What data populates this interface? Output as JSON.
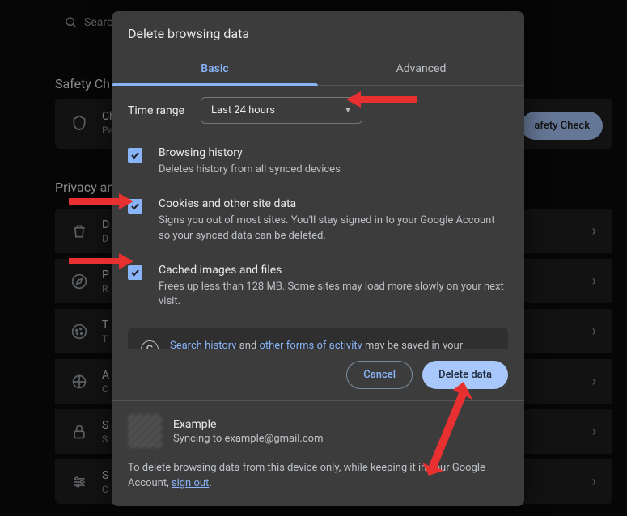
{
  "background": {
    "search_placeholder": "Searc",
    "safety_heading": "Safety Ch",
    "safety_card_title": "Ch",
    "safety_card_sub": "Pa",
    "safety_btn": "afety Check",
    "privacy_heading": "Privacy an",
    "rows": [
      {
        "icon": "trash",
        "title": "D",
        "sub": "D"
      },
      {
        "icon": "compass",
        "title": "P",
        "sub": "R"
      },
      {
        "icon": "cookie",
        "title": "T",
        "sub": "T"
      },
      {
        "icon": "tune",
        "title": "A",
        "sub": "C"
      },
      {
        "icon": "lock",
        "title": "S",
        "sub": "S"
      },
      {
        "icon": "sliders",
        "title": "S",
        "sub": "C"
      }
    ]
  },
  "dialog": {
    "title": "Delete browsing data",
    "tabs": {
      "basic": "Basic",
      "advanced": "Advanced"
    },
    "time_range_label": "Time range",
    "time_range_value": "Last 24 hours",
    "items": [
      {
        "checked": true,
        "title": "Browsing history",
        "desc": "Deletes history from all synced devices"
      },
      {
        "checked": true,
        "title": "Cookies and other site data",
        "desc": "Signs you out of most sites. You'll stay signed in to your Google Account so your synced data can be deleted."
      },
      {
        "checked": true,
        "title": "Cached images and files",
        "desc": "Frees up less than 128 MB. Some sites may load more slowly on your next visit."
      }
    ],
    "info": {
      "link1": "Search history",
      "mid1": " and ",
      "link2": "other forms of activity",
      "mid2": " may be saved in your Google Account when you're signed in. You can delete them anytime."
    },
    "buttons": {
      "cancel": "Cancel",
      "delete": "Delete data"
    },
    "account": {
      "name": "Example",
      "sync": "Syncing to example@gmail.com",
      "signout_pre": "To delete browsing data from this device only, while keeping it in your Google Account, ",
      "signout_link": "sign out",
      "signout_post": "."
    }
  }
}
